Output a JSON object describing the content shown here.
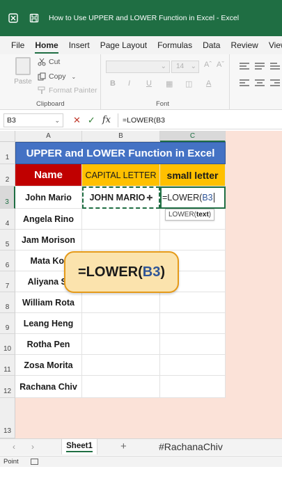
{
  "window": {
    "title": "How to Use UPPER and LOWER Function in Excel  -  Excel"
  },
  "menu": [
    "File",
    "Home",
    "Insert",
    "Page Layout",
    "Formulas",
    "Data",
    "Review",
    "View"
  ],
  "ribbon": {
    "paste": "Paste",
    "cut": "Cut",
    "copy": "Copy",
    "format_painter": "Format Painter",
    "clipboard_label": "Clipboard",
    "font_size": "14",
    "font_label": "Font",
    "font_style_buttons": [
      "B",
      "I",
      "U"
    ]
  },
  "formula_bar": {
    "name_box": "B3",
    "formula": "=LOWER(B3"
  },
  "columns": [
    "A",
    "B",
    "C"
  ],
  "rows": [
    "1",
    "2",
    "3",
    "4",
    "5",
    "6",
    "7",
    "8",
    "9",
    "10",
    "11",
    "12",
    "13"
  ],
  "sheet": {
    "title": "UPPER and LOWER Function in Excel",
    "headers": {
      "name": "Name",
      "capital": "CAPITAL LETTER",
      "small": "small letter"
    },
    "names": [
      "John Mario",
      "Angela Rino",
      "Jam Morison",
      "Mata Kol",
      "Aliyana Si",
      "William Rota",
      "Leang Heng",
      "Rotha Pen",
      "Zosa Morita",
      "Rachana Chiv"
    ],
    "b3_value": "JOHN MARIO",
    "c3_editing": {
      "prefix": "=LOWER(",
      "ref": "B3"
    }
  },
  "tooltip": {
    "func": "LOWER(",
    "arg": "text",
    "close": ")"
  },
  "callout": {
    "prefix": "=LOWER(",
    "ref": "B3",
    "suffix": ")"
  },
  "sheet_tabs": {
    "active": "Sheet1",
    "add": "+"
  },
  "watermark": "#RachanaChiv",
  "status": {
    "mode": "Point"
  },
  "colors": {
    "excel_green": "#1f6e43",
    "title_blue": "#4472c4",
    "header_red": "#c00000",
    "header_gold": "#ffc000",
    "callout_fill": "#fbe3ad"
  }
}
